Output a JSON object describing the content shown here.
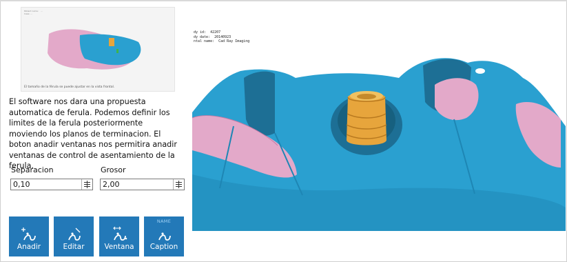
{
  "thumbnail": {
    "header": "Patient name:   …\nCase: …",
    "caption": "El tamaño de la férula se puede ajustar en la vista frontal."
  },
  "description": "El software nos dara una propuesta automatica de ferula. Podemos definir los limites de la ferula posteriormente moviendo los planos de terminacion. El boton anadir ventanas nos permitira anadir ventanas de control de asentamiento de la ferula.",
  "fields": {
    "separacion": {
      "label": "Separacion",
      "value": "0,10"
    },
    "grosor": {
      "label": "Grosor",
      "value": "2,00"
    }
  },
  "tools": [
    {
      "label": "Anadir",
      "icon": "add-tool-icon",
      "tag": ""
    },
    {
      "label": "Editar",
      "icon": "edit-tool-icon",
      "tag": ""
    },
    {
      "label": "Ventana",
      "icon": "window-tool-icon",
      "tag": ""
    },
    {
      "label": "Caption",
      "icon": "caption-tool-icon",
      "tag": "NAME"
    }
  ],
  "viewport": {
    "overlay_lines": [
      "dy id:  42207",
      "dy date:  20140923",
      "ntal name:  Cad Ray Imaging"
    ]
  },
  "colors": {
    "tool_button": "#2379b8",
    "model_blue": "#2aa0d0",
    "gingiva_pink": "#e3a9c9",
    "implant_gold": "#e7a53c"
  }
}
